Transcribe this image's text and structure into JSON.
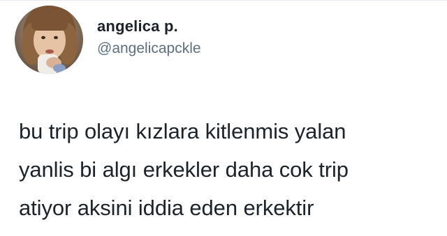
{
  "tweet": {
    "author": {
      "display_name": "angelica p.",
      "handle": "@angelicapckle",
      "avatar_icon": "profile-photo-avatar"
    },
    "text_lines": [
      "bu trip olayı kızlara kitlenmis yalan",
      "yanlis bi algı erkekler daha cok trip",
      "atiyor aksini iddia eden erkektir"
    ]
  },
  "colors": {
    "background": "#ffffff",
    "text": "#1c2329",
    "handle": "#5d6f7e",
    "divider": "#e6ecf0"
  }
}
